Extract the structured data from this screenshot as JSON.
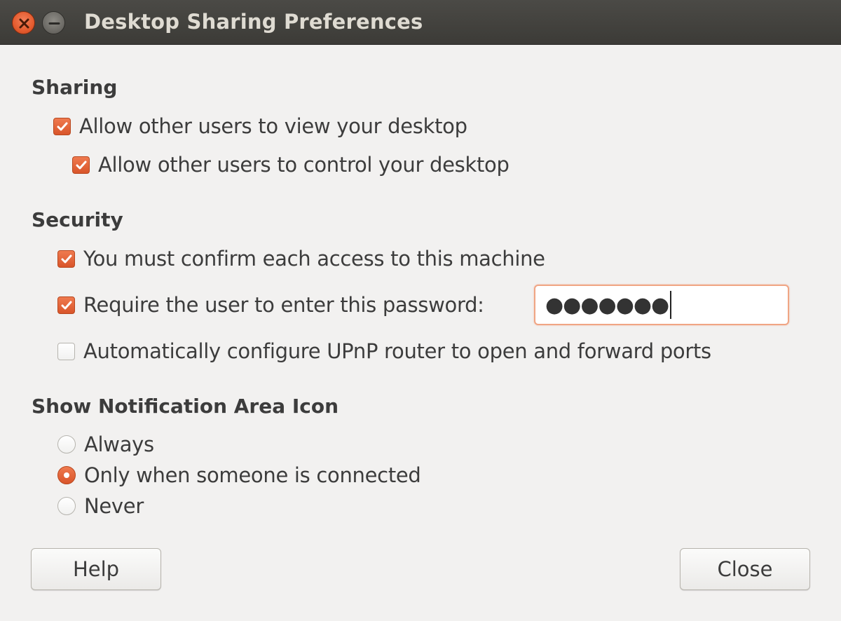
{
  "window": {
    "title": "Desktop Sharing Preferences"
  },
  "sharing": {
    "heading": "Sharing",
    "allow_view": {
      "label": "Allow other users to view your desktop",
      "checked": true
    },
    "allow_control": {
      "label": "Allow other users to control your desktop",
      "checked": true
    }
  },
  "security": {
    "heading": "Security",
    "confirm_access": {
      "label": "You must confirm each access to this machine",
      "checked": true
    },
    "require_password": {
      "label": "Require the user to enter this password:",
      "checked": true
    },
    "password_value": "●●●●●●●",
    "upnp": {
      "label": "Automatically configure UPnP router to open and forward ports",
      "checked": false
    }
  },
  "notification": {
    "heading": "Show Notification Area Icon",
    "options": [
      {
        "label": "Always",
        "selected": false
      },
      {
        "label": "Only when someone is connected",
        "selected": true
      },
      {
        "label": "Never",
        "selected": false
      }
    ]
  },
  "buttons": {
    "help": "Help",
    "close": "Close"
  },
  "colors": {
    "accent": "#e95420",
    "titlebar": "#3c3b37",
    "background": "#f2f1f0"
  },
  "icons": {
    "close": "close-icon",
    "minimize": "minimize-icon",
    "check": "checkmark-icon"
  }
}
